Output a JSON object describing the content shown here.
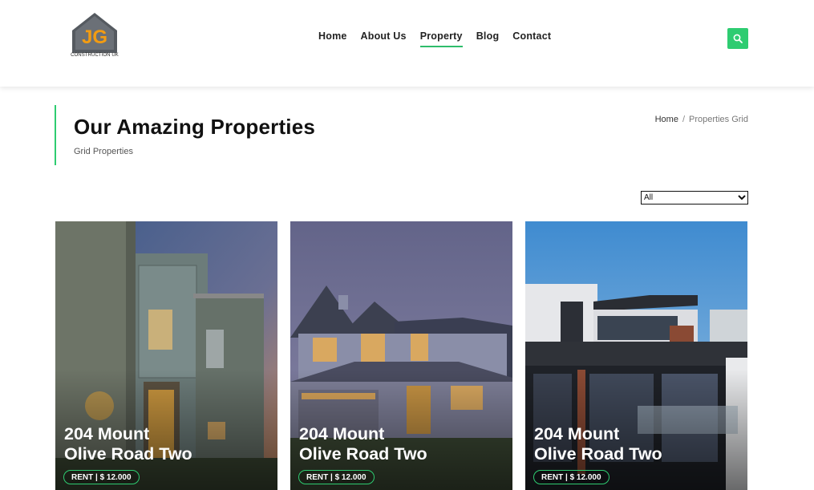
{
  "logo": {
    "initials": "JG",
    "caption": "CONSTRUCTION UK"
  },
  "nav": {
    "items": [
      "Home",
      "About Us",
      "Property",
      "Blog",
      "Contact"
    ],
    "active": "Property"
  },
  "search": {
    "icon": "search-icon"
  },
  "page": {
    "title": "Our Amazing Properties",
    "subtitle": "Grid Properties"
  },
  "breadcrumb": {
    "home": "Home",
    "separator": "/",
    "current": "Properties Grid"
  },
  "filter": {
    "selected": "All"
  },
  "cards": [
    {
      "title_line1": "204 Mount",
      "title_line2": "Olive Road Two",
      "badge": "RENT | $ 12.000"
    },
    {
      "title_line1": "204 Mount",
      "title_line2": "Olive Road Two",
      "badge": "RENT | $ 12.000"
    },
    {
      "title_line1": "204 Mount",
      "title_line2": "Olive Road Two",
      "badge": "RENT | $ 12.000"
    }
  ],
  "colors": {
    "accent": "#2ecc71",
    "text": "#111111"
  }
}
